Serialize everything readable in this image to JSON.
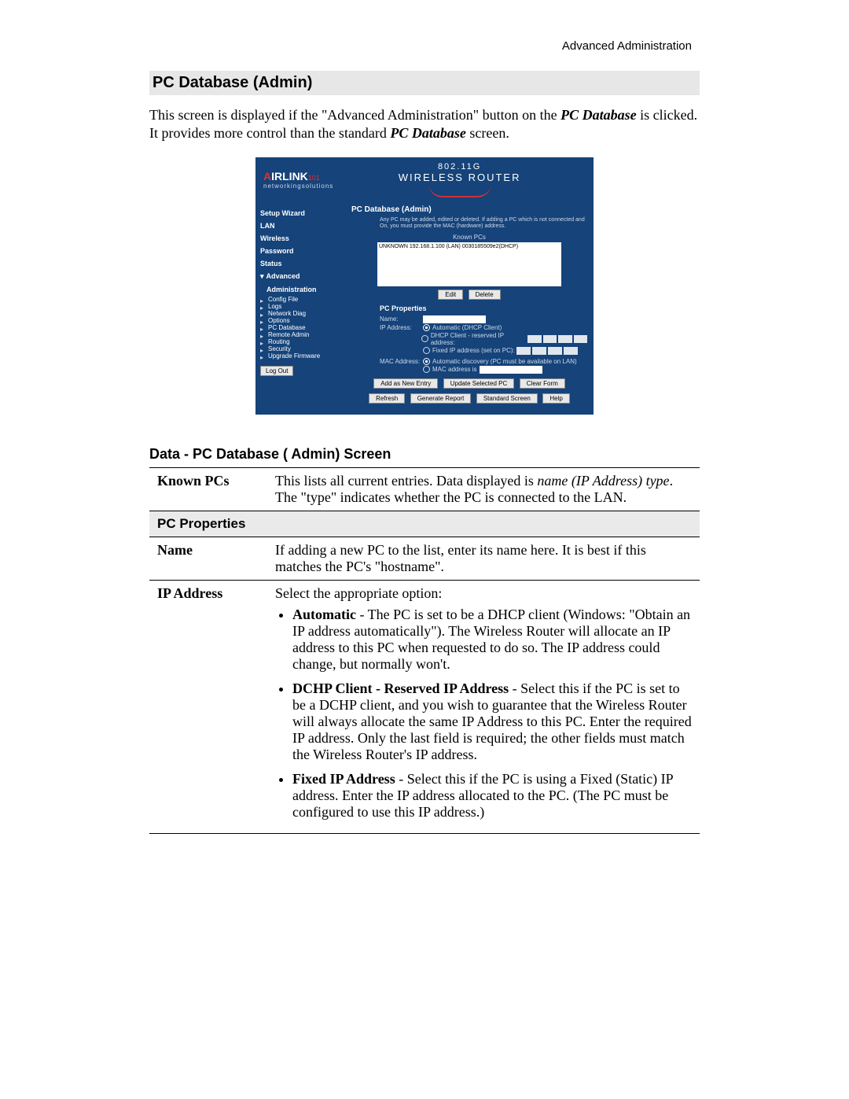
{
  "header_right": "Advanced Administration",
  "section_title": "PC Database (Admin)",
  "intro": {
    "p1a": "This screen is displayed if the \"Advanced Administration\" button on the ",
    "p1b": "PC Database",
    "p1c": " is clicked. It provides more control than the standard ",
    "p1d": "PC Database",
    "p1e": " screen."
  },
  "router": {
    "logo_line1a": "A",
    "logo_line1b": "IRLINK",
    "logo_line1c": "101",
    "logo_line2": "networkingsolutions",
    "title_line1": "802.11G",
    "title_line2": "WIRELESS ROUTER",
    "nav": [
      "Setup Wizard",
      "LAN",
      "Wireless",
      "Password",
      "Status"
    ],
    "nav_adv": "Advanced",
    "nav_admin": "Administration",
    "nav_sub": [
      "Config File",
      "Logs",
      "Network Diag",
      "Options",
      "PC Database",
      "Remote Admin",
      "Routing",
      "Security",
      "Upgrade Firmware"
    ],
    "logout": "Log Out",
    "main_title": "PC Database (Admin)",
    "main_note": "Any PC may be added, edited or deleted. If adding a PC which is not connected and On, you must provide the MAC (hardware) address.",
    "known_label": "Known PCs",
    "known_entry": "UNKNOWN 192.168.1.100 (LAN) 0030185509e2(DHCP)",
    "btn_edit": "Edit",
    "btn_delete": "Delete",
    "props_title": "PC Properties",
    "prop_name": "Name:",
    "prop_ip": "IP Address:",
    "ip_opt1": "Automatic (DHCP Client)",
    "ip_opt2": "DHCP Client - reserved IP address:",
    "ip_opt3": "Fixed IP address (set on PC):",
    "prop_mac": "MAC Address:",
    "mac_opt1": "Automatic discovery (PC must be available on LAN)",
    "mac_opt2": "MAC address is",
    "btn_add": "Add as New Entry",
    "btn_update": "Update Selected PC",
    "btn_clear": "Clear Form",
    "btn_refresh": "Refresh",
    "btn_report": "Generate Report",
    "btn_std": "Standard Screen",
    "btn_help": "Help"
  },
  "data_title": "Data - PC Database ( Admin) Screen",
  "table": {
    "known_label": "Known PCs",
    "known_text_a": "This lists all current entries. Data displayed is ",
    "known_text_b": "name (IP Address) type",
    "known_text_c": ". The \"type\" indicates whether the PC is connected to the LAN.",
    "props_header": "PC Properties",
    "name_label": "Name",
    "name_text": "If adding a new PC to the list, enter its name here. It is best if this matches the PC's \"hostname\".",
    "ip_label": "IP Address",
    "ip_intro": "Select the appropriate option:",
    "ip_b1_lead": "Automatic",
    "ip_b1_rest": " - The PC is set to be a DHCP client (Windows: \"Obtain an IP address automatically\"). The Wireless Router will allocate an IP address to this PC when requested to do so. The IP address could change, but normally won't.",
    "ip_b2_lead": "DCHP Client - Reserved IP Address",
    "ip_b2_rest": " - Select this if the PC is set to be a DCHP client, and you wish to guarantee that the Wireless Router will always allocate the same IP Address to this PC. Enter the required IP address. Only the last field is required; the other fields must match the Wireless Router's IP address.",
    "ip_b3_lead": "Fixed IP Address",
    "ip_b3_rest": " - Select this if the PC is using a Fixed (Static) IP address. Enter the IP address allocated to the PC. (The PC must be configured to use this IP address.)"
  }
}
